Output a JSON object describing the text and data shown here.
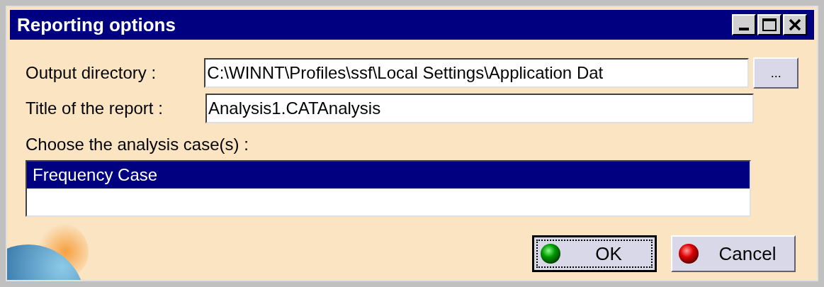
{
  "window": {
    "title": "Reporting options"
  },
  "fields": [
    {
      "label": "Output directory :",
      "value": "C:\\WINNT\\Profiles\\ssf\\Local Settings\\Application Dat",
      "browse": "..."
    },
    {
      "label": "Title of the report :",
      "value": "Analysis1.CATAnalysis"
    }
  ],
  "cases": {
    "label": "Choose the analysis case(s) :",
    "items": [
      {
        "label": "Frequency Case",
        "selected": true
      }
    ]
  },
  "buttons": [
    {
      "label": "OK",
      "kind": "ok",
      "default": true
    },
    {
      "label": "Cancel",
      "kind": "cancel",
      "default": false
    }
  ]
}
